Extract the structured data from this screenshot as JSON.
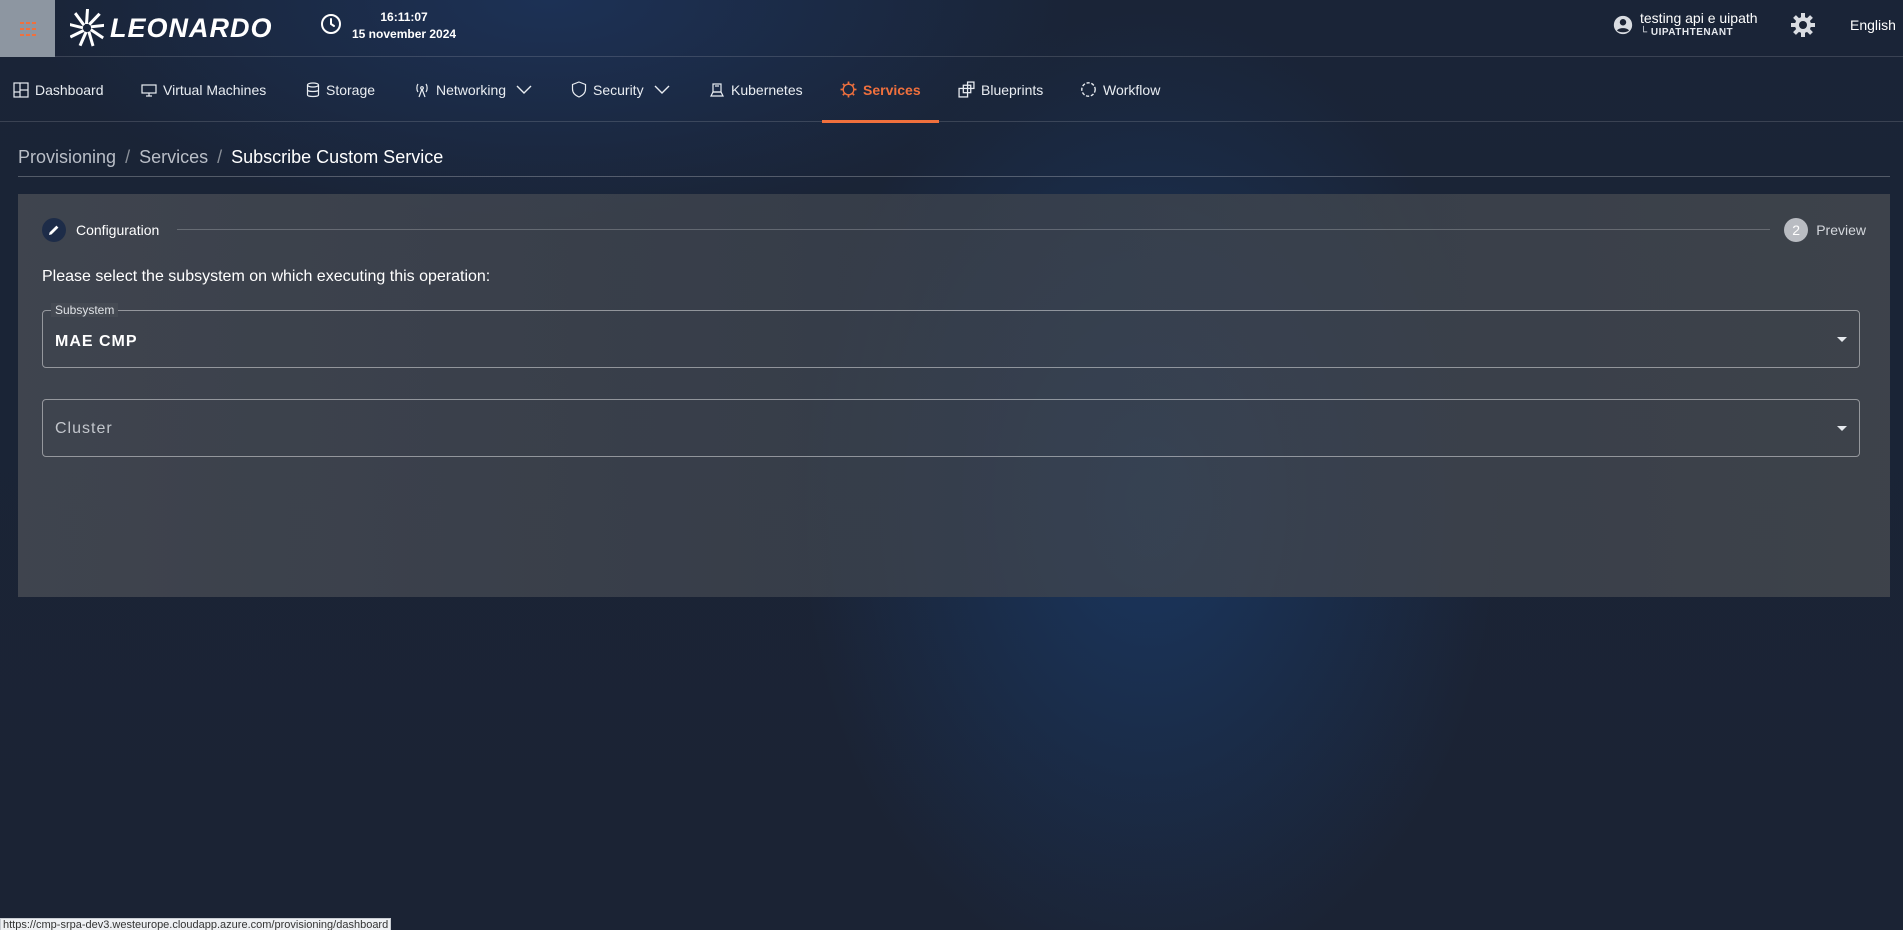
{
  "header": {
    "brand": "LEONARDO",
    "time": "16:11:07",
    "date": "15 november 2024",
    "user_name": "testing api e uipath",
    "tenant": "└ UIPATHTENANT",
    "language": "English",
    "menu_icon": "grid-menu-icon",
    "accent": "#f0703d"
  },
  "nav": {
    "items": [
      {
        "label": "Dashboard",
        "icon": "dashboard-icon"
      },
      {
        "label": "Virtual Machines",
        "icon": "monitor-icon"
      },
      {
        "label": "Storage",
        "icon": "database-icon"
      },
      {
        "label": "Networking",
        "icon": "antenna-icon"
      },
      {
        "label": "Security",
        "icon": "shield-icon"
      },
      {
        "label": "Kubernetes",
        "icon": "kubernetes-icon"
      },
      {
        "label": "Services",
        "icon": "services-gear-icon"
      },
      {
        "label": "Blueprints",
        "icon": "blueprints-icon"
      },
      {
        "label": "Workflow",
        "icon": "workflow-cycle-icon"
      }
    ],
    "active": "Services"
  },
  "breadcrumb": {
    "items": [
      "Provisioning",
      "Services"
    ],
    "current": "Subscribe Custom Service"
  },
  "stepper": {
    "step1_label": "Configuration",
    "step2_number": "2",
    "step2_label": "Preview"
  },
  "form": {
    "instruction": "Please select the subsystem on which executing this operation:",
    "subsystem": {
      "label": "Subsystem",
      "value": "MAE CMP"
    },
    "cluster": {
      "placeholder": "Cluster"
    }
  },
  "status_url": "https://cmp-srpa-dev3.westeurope.cloudapp.azure.com/provisioning/dashboard"
}
